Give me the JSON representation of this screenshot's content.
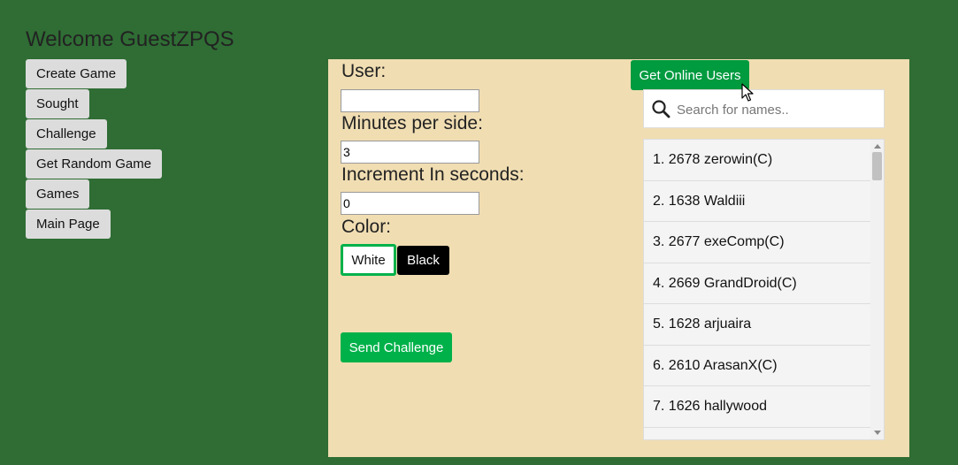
{
  "welcome": "Welcome GuestZPQS",
  "sidebar": {
    "items": [
      {
        "label": "Create Game"
      },
      {
        "label": "Sought"
      },
      {
        "label": "Challenge"
      },
      {
        "label": "Get Random Game"
      },
      {
        "label": "Games"
      },
      {
        "label": "Main Page"
      }
    ]
  },
  "form": {
    "user_label": "User:",
    "user_value": "",
    "minutes_label": "Minutes per side:",
    "minutes_value": "3",
    "increment_label": "Increment In seconds:",
    "increment_value": "0",
    "color_label": "Color:",
    "white_label": "White",
    "black_label": "Black",
    "selected_color": "White",
    "send_label": "Send Challenge"
  },
  "online": {
    "button_label": "Get Online Users",
    "search_placeholder": "Search for names..",
    "users": [
      "1. 2678 zerowin(C)",
      "2. 1638 Waldiii",
      "3. 2677 exeComp(C)",
      "4. 2669 GrandDroid(C)",
      "5. 1628 arjuaira",
      "6. 2610 ArasanX(C)",
      "7. 1626 hallywood"
    ]
  },
  "colors": {
    "background": "#2f6d34",
    "panel": "#f0ddb2",
    "accent": "#00b14a"
  }
}
